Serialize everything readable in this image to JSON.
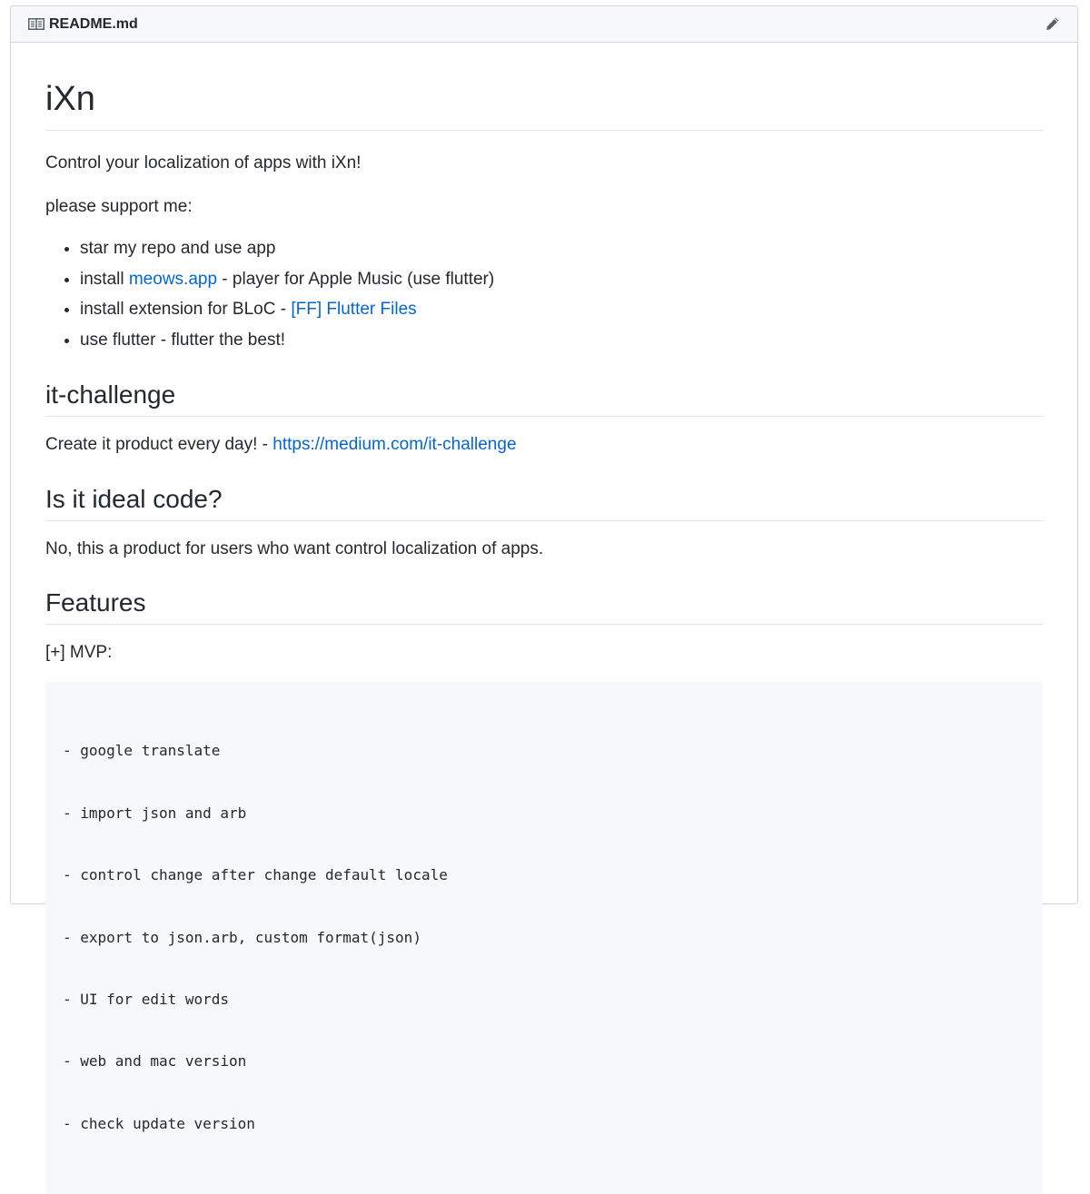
{
  "header": {
    "file_icon": "book-icon",
    "file_name": "README.md",
    "edit_icon": "pencil-icon"
  },
  "readme": {
    "title": "iXn",
    "intro": "Control your localization of apps with iXn!",
    "support_heading": "please support me:",
    "support_items": [
      {
        "text": "star my repo and use app"
      },
      {
        "before": "install ",
        "link": "meows.app",
        "after": " - player for Apple Music (use flutter)"
      },
      {
        "before": "install extension for BLoC - ",
        "link": "[FF] Flutter Files",
        "after": ""
      },
      {
        "text": "use flutter - flutter the best!"
      }
    ],
    "challenge": {
      "heading": "it-challenge",
      "text": "Create it product every day! - ",
      "link": "https://medium.com/it-challenge"
    },
    "ideal": {
      "heading": "Is it ideal code?",
      "text": "No, this a product for users who want control localization of apps."
    },
    "features": {
      "heading": "Features",
      "mvp_label": "[+] MVP:",
      "code_lines": [
        "- google translate",
        "- import json and arb",
        "- control change after change default locale",
        "- export to json.arb, custom format(json)",
        "- UI for edit words",
        "- web and mac version",
        "- check update version"
      ]
    }
  },
  "colors": {
    "link": "#0366d6",
    "text": "#24292e",
    "header_bg": "#f6f8fa",
    "border": "#d1d5da",
    "code_bg": "#f6f8fa"
  }
}
